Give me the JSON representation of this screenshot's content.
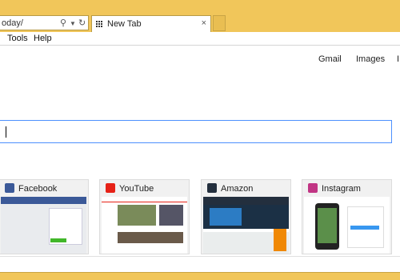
{
  "browser": {
    "address_text": "oday/",
    "tab_title": "New Tab",
    "close_glyph": "×"
  },
  "menu": {
    "tools": "Tools",
    "help": "Help"
  },
  "header_links": {
    "gmail": "Gmail",
    "images": "Images",
    "apps_partial": "I"
  },
  "search": {
    "value": ""
  },
  "tiles": [
    {
      "title": "Facebook",
      "icon": "facebook-icon",
      "color": "#3b5998"
    },
    {
      "title": "YouTube",
      "icon": "youtube-icon",
      "color": "#e62117"
    },
    {
      "title": "Amazon",
      "icon": "amazon-icon",
      "color": "#232f3e"
    },
    {
      "title": "Instagram",
      "icon": "instagram-icon",
      "color": "#c13584"
    }
  ],
  "colors": {
    "chrome": "#f1c65a",
    "focus_border": "#4d90fe"
  }
}
